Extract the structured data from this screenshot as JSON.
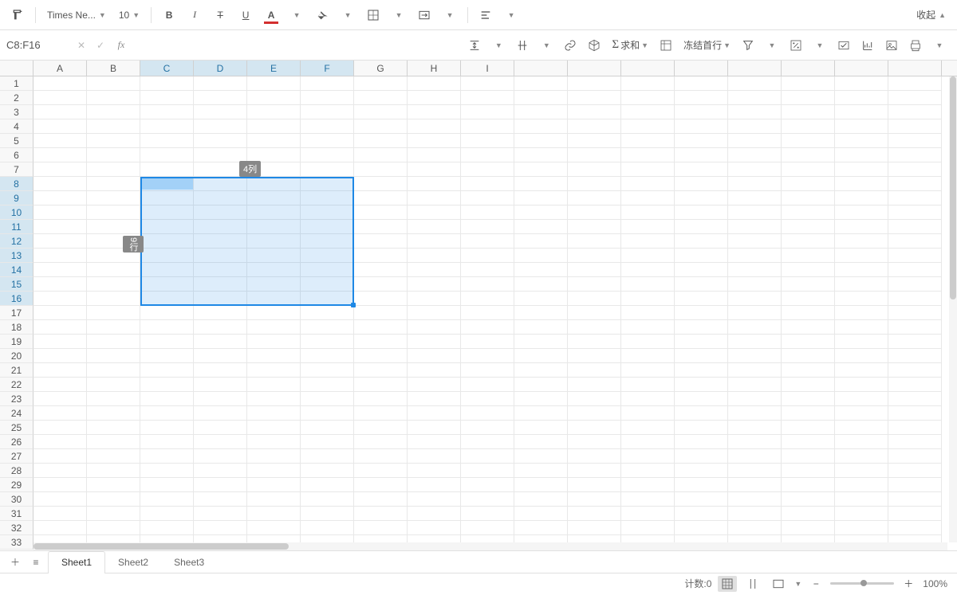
{
  "toolbar": {
    "font_family": "Times Ne...",
    "font_size": "10",
    "collapse_label": "收起"
  },
  "formula_bar": {
    "cell_reference": "C8:F16",
    "formula_value": ""
  },
  "secondary_toolbar": {
    "sum_label": "求和",
    "freeze_label": "冻结首行"
  },
  "columns": [
    "A",
    "B",
    "C",
    "D",
    "E",
    "F",
    "G",
    "H",
    "I",
    "",
    "",
    "",
    "",
    "",
    "",
    "",
    ""
  ],
  "selected_columns": [
    "C",
    "D",
    "E",
    "F"
  ],
  "row_count": 33,
  "selected_rows_start": 8,
  "selected_rows_end": 16,
  "selection_badges": {
    "cols": "4列",
    "rows": "9行"
  },
  "sheet_tabs": [
    "Sheet1",
    "Sheet2",
    "Sheet3"
  ],
  "active_sheet": 0,
  "status_bar": {
    "count_label": "计数:0",
    "zoom_value": "100%"
  }
}
